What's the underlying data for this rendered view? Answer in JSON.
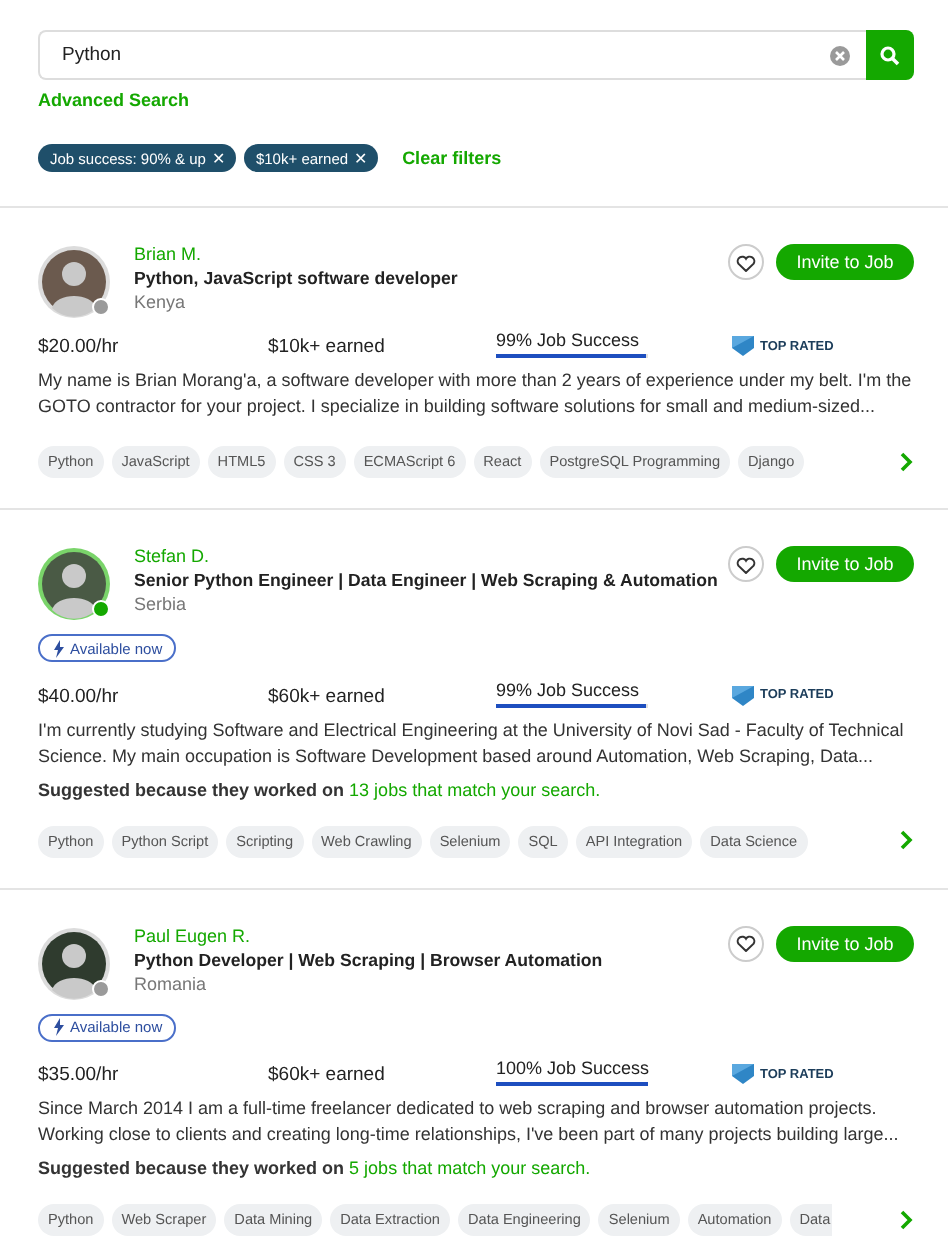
{
  "search": {
    "value": "Python",
    "advanced_link": "Advanced Search"
  },
  "filters": [
    {
      "label": "Job success: 90% & up",
      "remove": "✕"
    },
    {
      "label": "$10k+ earned",
      "remove": "✕"
    }
  ],
  "clear_filters": "Clear filters",
  "freelancers": [
    {
      "name": "Brian M.",
      "title": "Python, JavaScript software developer",
      "country": "Kenya",
      "online": false,
      "rate": "$20.00/hr",
      "earned": "$10k+ earned",
      "job_success": {
        "text": "99% Job Success",
        "level": 0.99
      },
      "badge": "TOP RATED",
      "description": "My name is Brian Morang'a, a software developer with more than 2 years of experience under my belt. I'm the GOTO contractor for your project. I specialize in building software solutions for small and medium-sized...",
      "skills": [
        "Python",
        "JavaScript",
        "HTML5",
        "CSS 3",
        "ECMAScript 6",
        "React",
        "PostgreSQL Programming",
        "Django"
      ],
      "invite": "Invite to Job"
    },
    {
      "name": "Stefan D.",
      "title": "Senior Python Engineer | Data Engineer | Web Scraping & Automation",
      "country": "Serbia",
      "online": true,
      "available": "Available now",
      "rate": "$40.00/hr",
      "earned": "$60k+ earned",
      "job_success": {
        "text": "99% Job Success",
        "level": 0.99
      },
      "badge": "TOP RATED",
      "description": "I'm currently studying Software and Electrical Engineering at the University of Novi Sad - Faculty of Technical Science. My main occupation is Software Development based around Automation, Web Scraping, Data...",
      "suggested": {
        "text": "Suggested because they worked on",
        "link": "13 jobs that match your search."
      },
      "skills": [
        "Python",
        "Python Script",
        "Scripting",
        "Web Crawling",
        "Selenium",
        "SQL",
        "API Integration",
        "Data Science"
      ],
      "invite": "Invite to Job"
    },
    {
      "name": "Paul Eugen R.",
      "title": "Python Developer | Web Scraping | Browser Automation",
      "country": "Romania",
      "online": false,
      "available": "Available now",
      "rate": "$35.00/hr",
      "earned": "$60k+ earned",
      "job_success": {
        "text": "100% Job Success",
        "level": 1.0
      },
      "badge": "TOP RATED",
      "description": "Since March 2014 I am a full-time freelancer dedicated to web scraping and browser automation projects. Working close to clients and creating long-time relationships, I've been part of many projects building large...",
      "suggested": {
        "text": "Suggested because they worked on",
        "link": "5 jobs that match your search."
      },
      "skills": [
        "Python",
        "Web Scraper",
        "Data Mining",
        "Data Extraction",
        "Data Engineering",
        "Selenium",
        "Automation"
      ],
      "skills_cut": "Data",
      "invite": "Invite to Job"
    }
  ]
}
